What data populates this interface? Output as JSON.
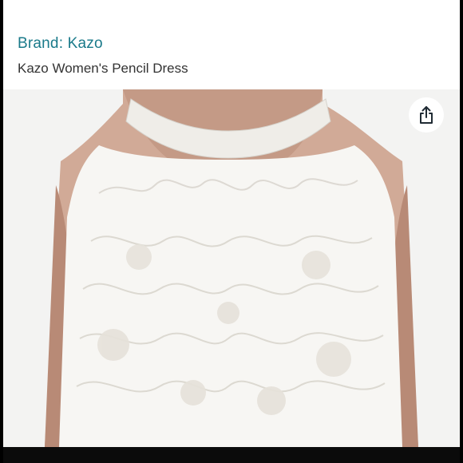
{
  "product": {
    "brand_label": "Brand: Kazo",
    "title": "Kazo Women's Pencil Dress"
  },
  "colors": {
    "brand_link": "#1a7a8a",
    "title_text": "#333333",
    "background": "#ffffff",
    "frame": "#000000"
  },
  "icons": {
    "share": "share-icon"
  }
}
